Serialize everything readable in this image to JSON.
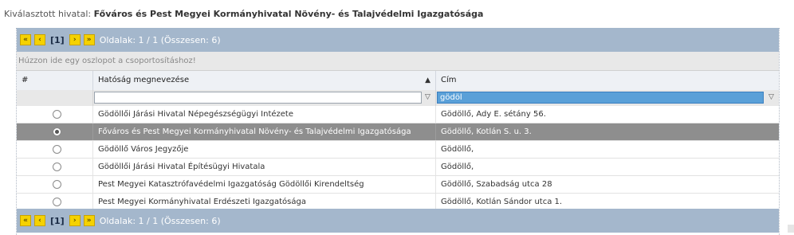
{
  "selected_office": {
    "label": "Kiválasztott hivatal:",
    "value": "Főváros és Pest Megyei Kormányhivatal Növény- és Talajvédelmi Igazgatósága"
  },
  "pager_top": {
    "first": "«",
    "prev": "‹",
    "current_page": "[1]",
    "next": "›",
    "last": "»",
    "info": "Oldalak: 1 / 1 (Összesen: 6)"
  },
  "pager_bottom": {
    "first": "«",
    "prev": "‹",
    "current_page": "[1]",
    "next": "›",
    "last": "»",
    "info": "Oldalak: 1 / 1 (Összesen: 6)"
  },
  "group_panel": "Húzzon ide egy oszlopot a csoportosításhoz!",
  "columns": {
    "num": "#",
    "authority": "Hatóság megnevezése",
    "address": "Cím",
    "sort_icon": "▲"
  },
  "filters": {
    "authority_value": "",
    "address_value": "gödöl",
    "filter_icon": "▽"
  },
  "rows": [
    {
      "authority": "Gödöllői Járási Hivatal Népegészségügyi Intézete",
      "address": "Gödöllő, Ady E. sétány 56.",
      "selected": false
    },
    {
      "authority": "Főváros és Pest Megyei Kormányhivatal Növény- és Talajvédelmi Igazgatósága",
      "address": "Gödöllő, Kotlán S. u. 3.",
      "selected": true
    },
    {
      "authority": "Gödöllő Város Jegyzője",
      "address": "Gödöllő,",
      "selected": false
    },
    {
      "authority": "Gödöllői Járási Hivatal Építésügyi Hivatala",
      "address": "Gödöllő,",
      "selected": false
    },
    {
      "authority": "Pest Megyei Katasztrófavédelmi Igazgatóság Gödöllői Kirendeltség",
      "address": "Gödöllő, Szabadság utca 28",
      "selected": false
    },
    {
      "authority": "Pest Megyei Kormányhivatal Erdészeti Igazgatósága",
      "address": "Gödöllő, Kotlán Sándor utca 1.",
      "selected": false
    }
  ]
}
